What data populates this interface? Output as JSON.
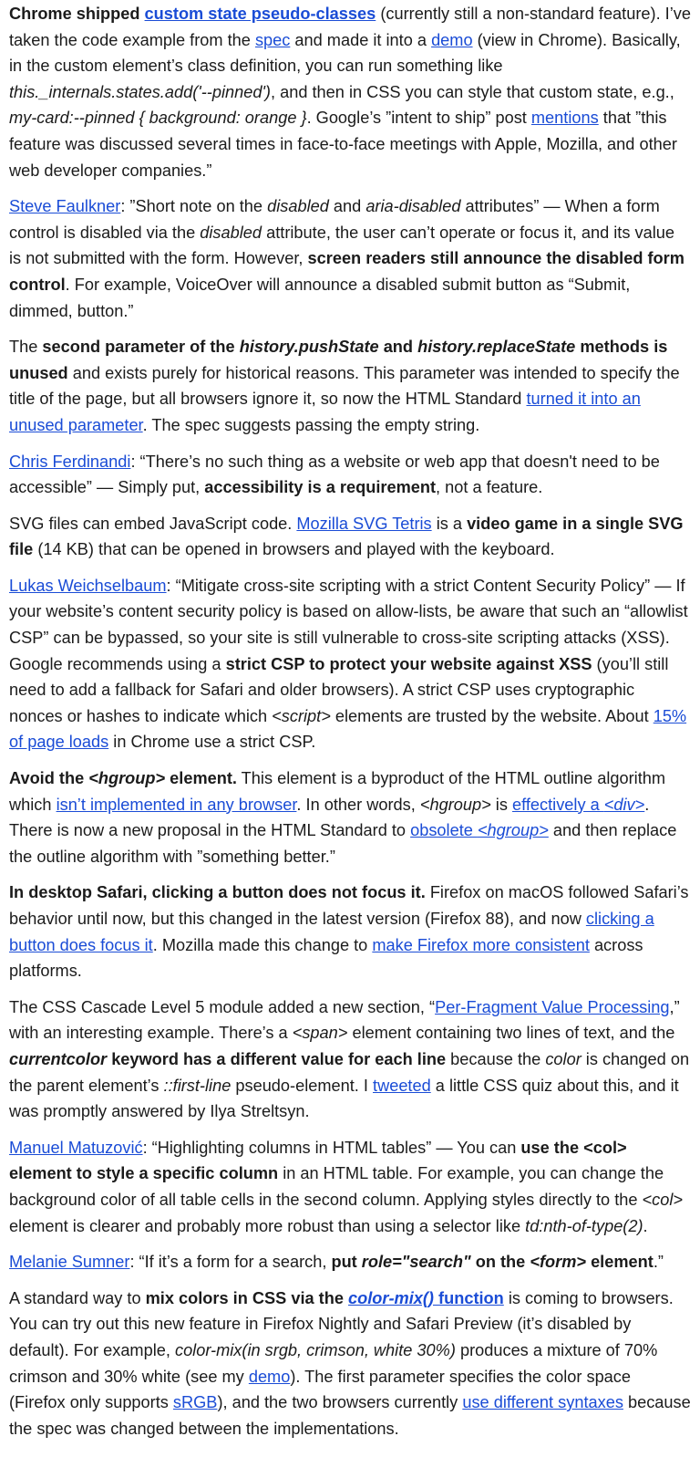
{
  "colors": {
    "text": "#1b1b1b",
    "link": "#1a4cd6",
    "background": "#ffffff"
  },
  "paragraphs": [
    [
      {
        "t": "Chrome shipped ",
        "b": 1
      },
      {
        "t": "custom state pseudo-classes",
        "b": 1,
        "link": 1
      },
      {
        "t": " (currently still a non-standard feature). I’ve taken the code example from the "
      },
      {
        "t": "spec",
        "link": 1
      },
      {
        "t": " and made it into a "
      },
      {
        "t": "demo",
        "link": 1
      },
      {
        "t": " (view in Chrome). Basically, in the custom element’s class definition, you can run something like "
      },
      {
        "t": "this._internals.states.add('--pinned')",
        "i": 1
      },
      {
        "t": ", and then in CSS you can style that custom state, e.g., "
      },
      {
        "t": "my-card:--pinned { background: orange }",
        "i": 1
      },
      {
        "t": ". Google’s ”intent to ship” post "
      },
      {
        "t": "mentions",
        "link": 1
      },
      {
        "t": " that ”this feature was discussed several times in face-to-face meetings with Apple, Mozilla, and other web developer companies.”"
      }
    ],
    [
      {
        "t": "Steve Faulkner",
        "link": 1
      },
      {
        "t": ": ”Short note on the "
      },
      {
        "t": "disabled",
        "i": 1
      },
      {
        "t": " and "
      },
      {
        "t": "aria-disabled",
        "i": 1
      },
      {
        "t": " attributes” — When a form control is disabled via the "
      },
      {
        "t": "disabled",
        "i": 1
      },
      {
        "t": " attribute, the user can’t operate or focus it, and its value is not submitted with the form. However, "
      },
      {
        "t": "screen readers still announce the disabled form control",
        "b": 1
      },
      {
        "t": ". For example, VoiceOver will announce a disabled submit button as  “Submit, dimmed, button.”"
      }
    ],
    [
      {
        "t": "The "
      },
      {
        "t": "second parameter of the ",
        "b": 1
      },
      {
        "t": "history.pushState",
        "b": 1,
        "i": 1
      },
      {
        "t": " and ",
        "b": 1
      },
      {
        "t": "history.replaceState",
        "b": 1,
        "i": 1
      },
      {
        "t": " methods is unused",
        "b": 1
      },
      {
        "t": " and exists purely for historical reasons. This parameter was intended to specify the title of the page, but all browsers ignore it, so now the HTML Standard "
      },
      {
        "t": "turned it into an unused parameter",
        "link": 1
      },
      {
        "t": ". The spec suggests passing the empty string."
      }
    ],
    [
      {
        "t": "Chris Ferdinandi",
        "link": 1
      },
      {
        "t": ": “There’s no such thing as a website or web app that doesn't need to be accessible” — Simply put, "
      },
      {
        "t": "accessibility is a requirement",
        "b": 1
      },
      {
        "t": ", not a feature."
      }
    ],
    [
      {
        "t": "SVG files can embed JavaScript code. "
      },
      {
        "t": "Mozilla SVG Tetris",
        "link": 1
      },
      {
        "t": " is a "
      },
      {
        "t": "video game in a single SVG file",
        "b": 1
      },
      {
        "t": " (14 KB) that can be opened in browsers and played with the keyboard."
      }
    ],
    [
      {
        "t": "Lukas Weichselbaum",
        "link": 1
      },
      {
        "t": ": “Mitigate cross-site scripting with a strict Content Security Policy” — If your website’s content security policy is based on allow-lists, be aware that such an “allowlist CSP” can be bypassed, so your site is still vulnerable to cross-site scripting attacks (XSS). Google recommends using a "
      },
      {
        "t": "strict CSP to protect your website against XSS",
        "b": 1
      },
      {
        "t": " (you’ll still need to add a fallback for Safari and older browsers). A strict CSP uses cryptographic nonces or hashes to indicate which "
      },
      {
        "t": "<script>",
        "i": 1
      },
      {
        "t": " elements are trusted by the website. About "
      },
      {
        "t": "15% of page loads",
        "link": 1
      },
      {
        "t": " in Chrome use a strict CSP."
      }
    ],
    [
      {
        "t": "Avoid the ",
        "b": 1
      },
      {
        "t": "<hgroup>",
        "b": 1,
        "i": 1
      },
      {
        "t": " element.",
        "b": 1
      },
      {
        "t": " This element is a byproduct of the HTML outline algorithm which "
      },
      {
        "t": "isn’t implemented in any browser",
        "link": 1
      },
      {
        "t": ". In other words, "
      },
      {
        "t": "<hgroup>",
        "i": 1
      },
      {
        "t": " is "
      },
      {
        "t": "effectively a ",
        "link": 1
      },
      {
        "t": "<div>",
        "link": 1,
        "i": 1
      },
      {
        "t": ". There is now a new proposal in the HTML Standard to "
      },
      {
        "t": "obsolete ",
        "link": 1
      },
      {
        "t": "<hgroup>",
        "link": 1,
        "i": 1
      },
      {
        "t": " and then replace the outline algorithm with ”something better.”"
      }
    ],
    [
      {
        "t": "In desktop Safari, clicking a button does not focus it.",
        "b": 1
      },
      {
        "t": " Firefox on macOS followed Safari’s behavior until now, but this changed in the latest version (Firefox 88), and now "
      },
      {
        "t": "clicking a button does focus it",
        "link": 1
      },
      {
        "t": ". Mozilla made this change to "
      },
      {
        "t": "make Firefox more consistent",
        "link": 1
      },
      {
        "t": " across platforms."
      }
    ],
    [
      {
        "t": "The CSS Cascade Level 5 module added a new section, “"
      },
      {
        "t": "Per-Fragment Value Processing",
        "link": 1
      },
      {
        "t": ",” with an interesting example. There’s a "
      },
      {
        "t": "<span>",
        "i": 1
      },
      {
        "t": " element containing two lines of text, and the "
      },
      {
        "t": "currentcolor",
        "b": 1,
        "i": 1
      },
      {
        "t": " keyword has a different value for each line",
        "b": 1
      },
      {
        "t": " because the "
      },
      {
        "t": "color",
        "i": 1
      },
      {
        "t": " is changed on the parent element’s "
      },
      {
        "t": "::first-line",
        "i": 1
      },
      {
        "t": " pseudo-element. I "
      },
      {
        "t": "tweeted",
        "link": 1
      },
      {
        "t": " a little CSS quiz about this, and it  was promptly answered by Ilya Streltsyn."
      }
    ],
    [
      {
        "t": "Manuel Matuzović",
        "link": 1
      },
      {
        "t": ": “Highlighting columns in HTML tables” — You can "
      },
      {
        "t": "use the <col> element to style a specific column",
        "b": 1
      },
      {
        "t": " in an HTML table. For example, you can change the background color of all table cells in the second column. Applying styles directly to the "
      },
      {
        "t": "<col>",
        "i": 1
      },
      {
        "t": " element is clearer and probably more robust than using a selector like "
      },
      {
        "t": "td:nth-of-type(2)",
        "i": 1
      },
      {
        "t": "."
      }
    ],
    [
      {
        "t": "Melanie Sumner",
        "link": 1
      },
      {
        "t": ": “If it’s a form for a search, "
      },
      {
        "t": "put ",
        "b": 1
      },
      {
        "t": "role=\"search\"",
        "b": 1,
        "i": 1
      },
      {
        "t": " on the ",
        "b": 1
      },
      {
        "t": "<form>",
        "b": 1,
        "i": 1
      },
      {
        "t": " element",
        "b": 1
      },
      {
        "t": ".”"
      }
    ],
    [
      {
        "t": "A standard way to "
      },
      {
        "t": "mix colors in CSS via the ",
        "b": 1
      },
      {
        "t": "color-mix()",
        "b": 1,
        "i": 1,
        "link": 1
      },
      {
        "t": " function",
        "b": 1,
        "link": 1
      },
      {
        "t": " is coming to browsers. You can try out this new feature in Firefox Nightly and Safari Preview (it’s disabled by default). For example, "
      },
      {
        "t": "color-mix(in srgb, crimson, white 30%)",
        "i": 1
      },
      {
        "t": " produces a mixture of 70% crimson and 30% white (see my "
      },
      {
        "t": "demo",
        "link": 1
      },
      {
        "t": "). The first parameter specifies the color space (Firefox only supports "
      },
      {
        "t": "sRGB",
        "link": 1
      },
      {
        "t": "), and the two browsers currently "
      },
      {
        "t": "use different syntaxes",
        "link": 1
      },
      {
        "t": " because the spec was changed between the implementations."
      }
    ]
  ]
}
